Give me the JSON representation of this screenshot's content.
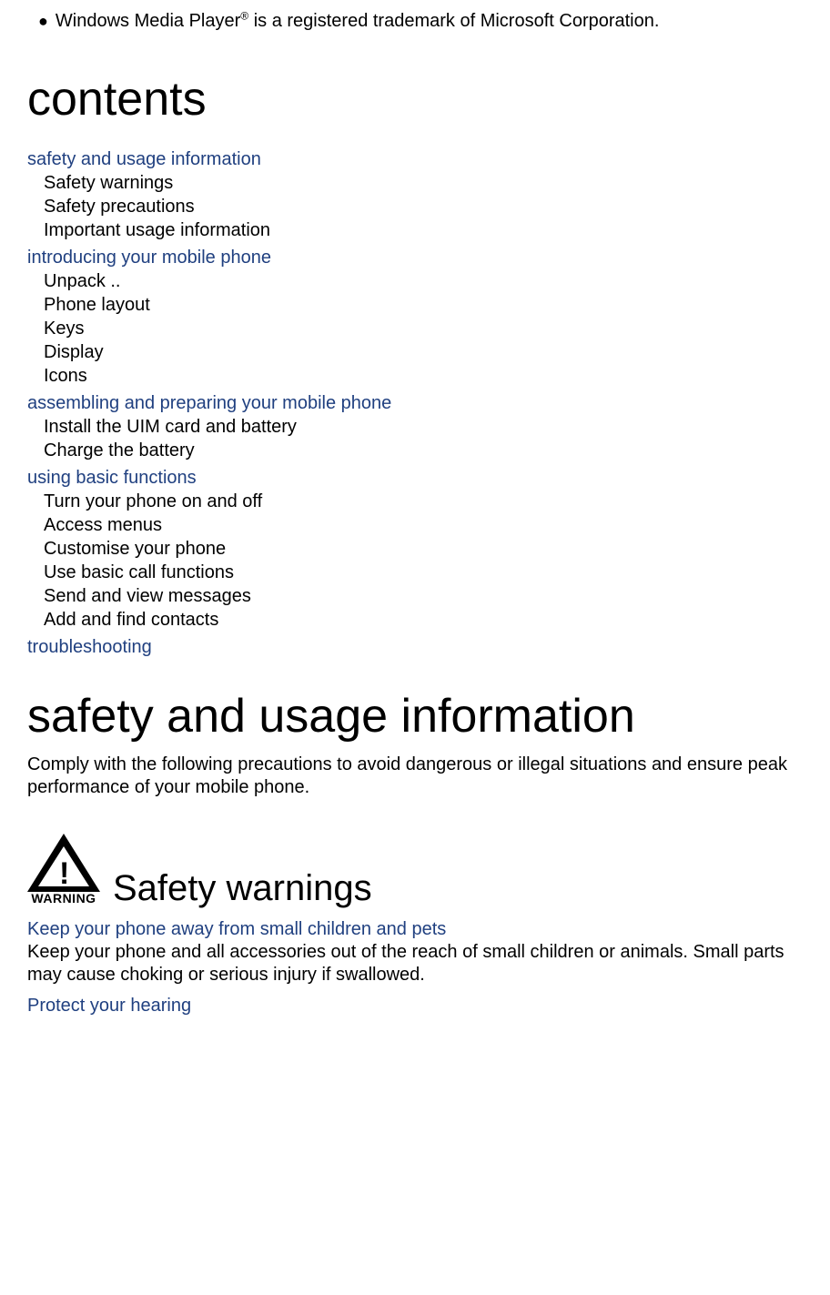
{
  "trademark": {
    "prefix": "Windows   Media Player",
    "sup": "®",
    "suffix": " is a registered trademark of Microsoft Corporation."
  },
  "contents_title": "contents",
  "toc": {
    "sections": [
      {
        "title": "safety and usage information",
        "items": [
          "Safety warnings",
          "Safety precautions",
          "Important usage information"
        ]
      },
      {
        "title": "introducing your mobile phone",
        "items": [
          "Unpack ..",
          "Phone layout",
          "Keys",
          "Display",
          "Icons"
        ]
      },
      {
        "title": "assembling and preparing your mobile phone",
        "items": [
          "Install the UIM card and battery",
          "Charge the battery"
        ]
      },
      {
        "title": "using basic functions",
        "items": [
          "Turn your phone on and off",
          "Access menus",
          "Customise your phone",
          "Use basic call functions",
          "Send and view messages",
          "Add and find contacts"
        ]
      },
      {
        "title": "troubleshooting",
        "items": []
      }
    ]
  },
  "body_title": "safety and usage information",
  "body_paragraph": "Comply with the following precautions to avoid dangerous or illegal situations and ensure peak performance of your mobile phone.",
  "warning_label": "WARNING",
  "warnings_title": "Safety  warnings",
  "sub1": {
    "head": "Keep your phone away from small children and pets",
    "text": "Keep your phone and all accessories out of the reach of small children or animals. Small parts may cause choking or serious injury if swallowed."
  },
  "sub2": {
    "head": "Protect your hearing"
  }
}
